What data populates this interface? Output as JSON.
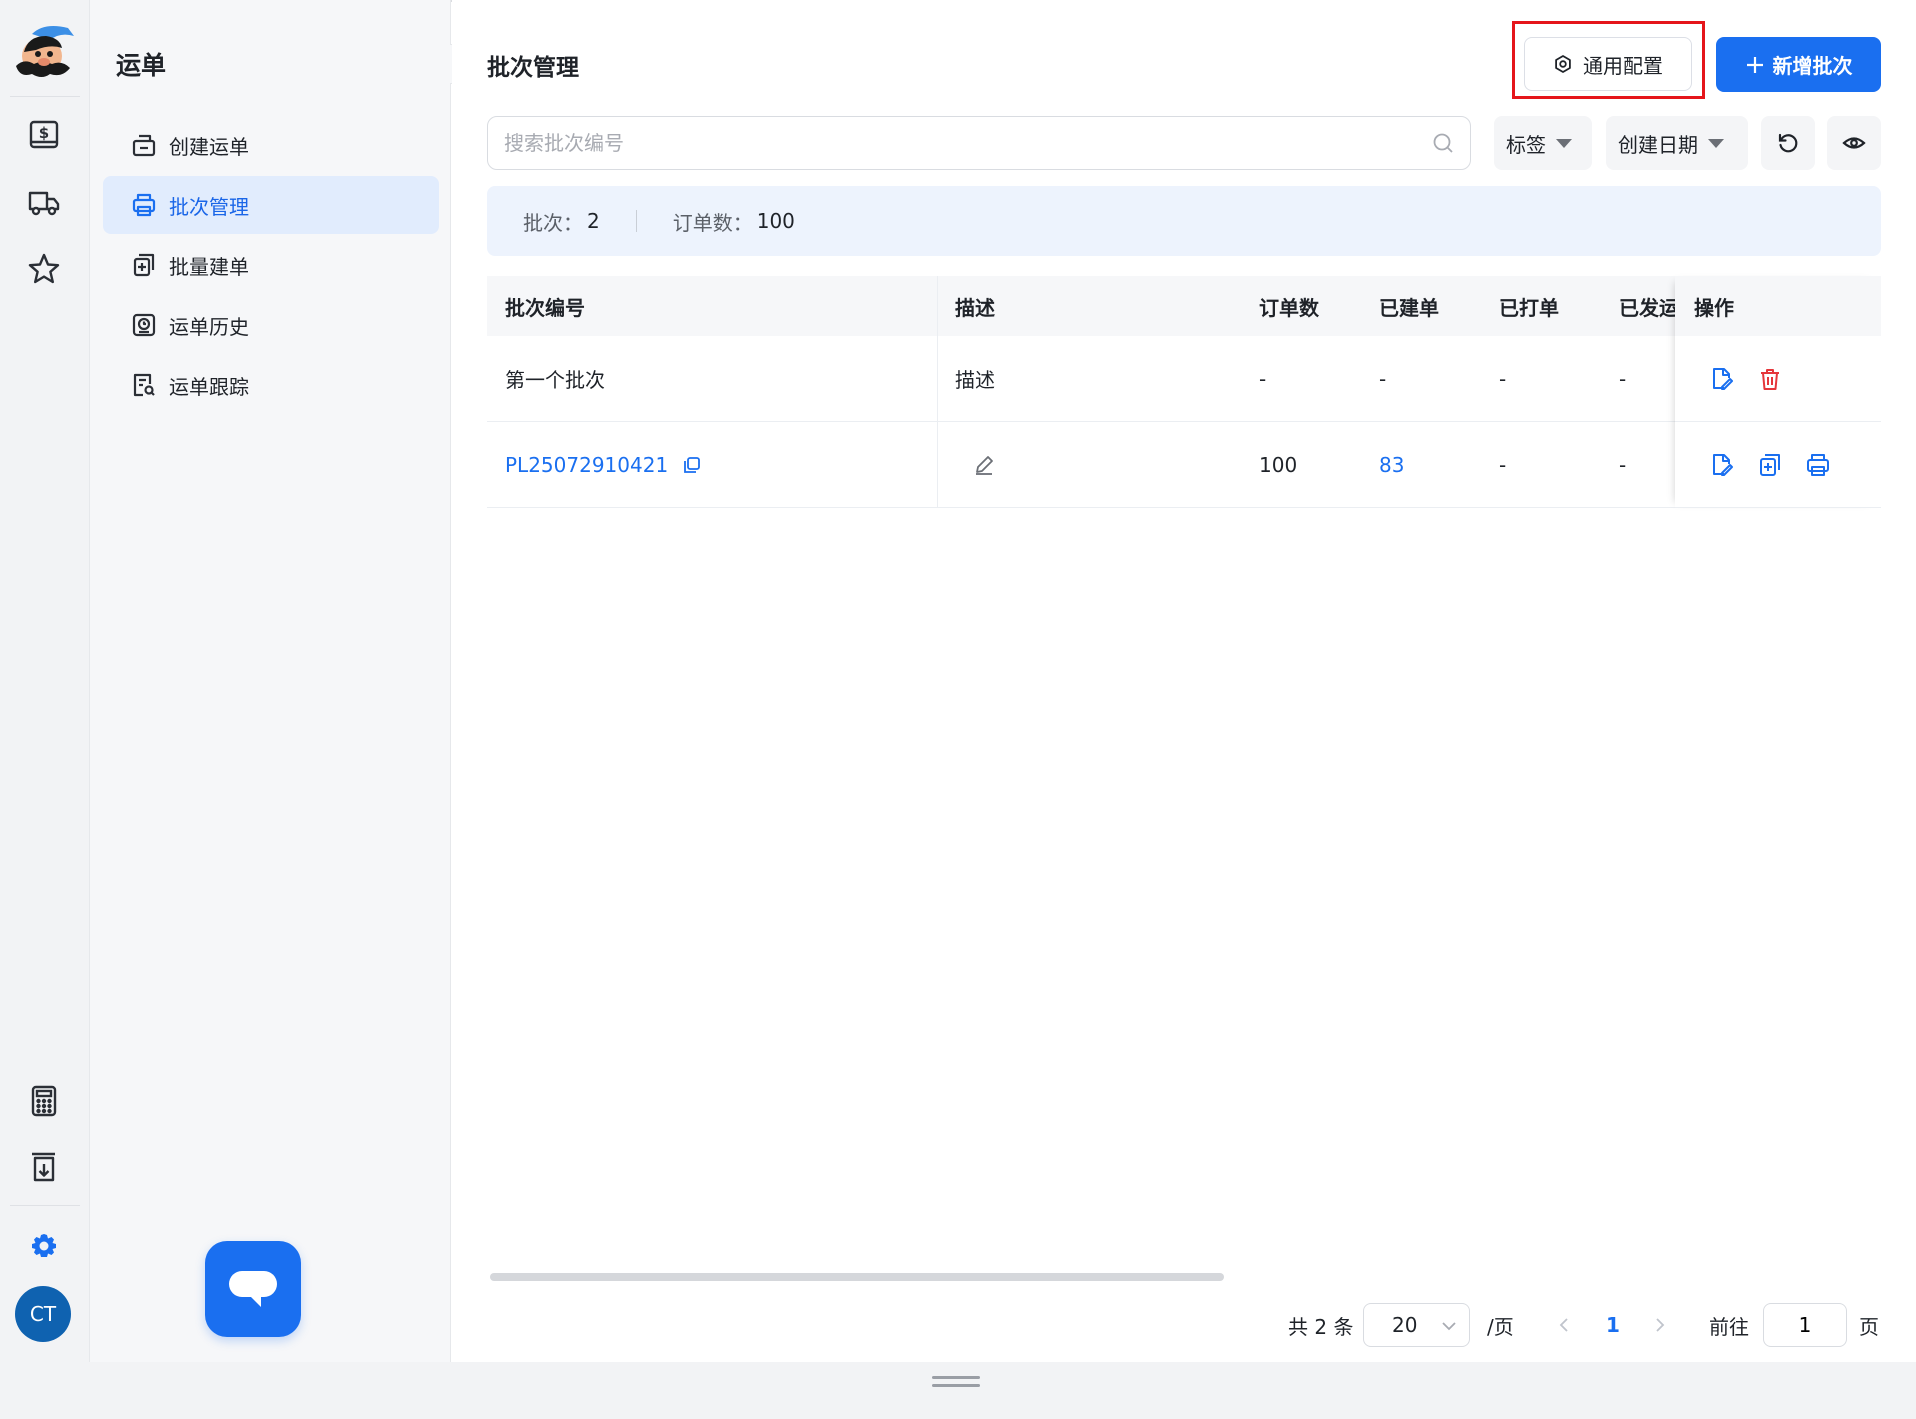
{
  "sidebar": {
    "title": "运单",
    "items": [
      {
        "label": "创建运单",
        "icon": "create-waybill-icon"
      },
      {
        "label": "批次管理",
        "icon": "printer-icon",
        "active": true
      },
      {
        "label": "批量建单",
        "icon": "batch-add-icon"
      },
      {
        "label": "运单历史",
        "icon": "history-icon"
      },
      {
        "label": "运单跟踪",
        "icon": "track-icon"
      }
    ]
  },
  "rail": {
    "icons": [
      "logo-mascot",
      "dollar-icon",
      "truck-icon",
      "star-icon",
      "calculator-icon",
      "download-icon",
      "gear-icon"
    ],
    "avatar_initials": "CT"
  },
  "header": {
    "title": "批次管理",
    "config_button": "通用配置",
    "new_button": "新增批次"
  },
  "toolbar": {
    "search_placeholder": "搜索批次编号",
    "tag_filter": "标签",
    "date_filter": "创建日期"
  },
  "summary": {
    "batch_label": "批次：",
    "batch_count": "2",
    "order_label": "订单数：",
    "order_count": "100"
  },
  "table": {
    "columns": [
      "批次编号",
      "描述",
      "订单数",
      "已建单",
      "已打单",
      "已发运",
      "操作"
    ],
    "rows": [
      {
        "batch_no": "第一个批次",
        "desc": "描述",
        "orders": "-",
        "created": "-",
        "printed": "-",
        "shipped": "-"
      },
      {
        "batch_no": "PL25072910421",
        "desc": "",
        "orders": "100",
        "created": "83",
        "printed": "-",
        "shipped": "-"
      }
    ]
  },
  "pagination": {
    "total_text": "共 2 条",
    "page_size": "20",
    "per_page": "/页",
    "current_page": "1",
    "goto_label": "前往",
    "goto_value": "1",
    "page_suffix": "页"
  },
  "colors": {
    "primary": "#1a6ff0",
    "danger": "#e5363b",
    "highlight_box": "#e5161b"
  }
}
